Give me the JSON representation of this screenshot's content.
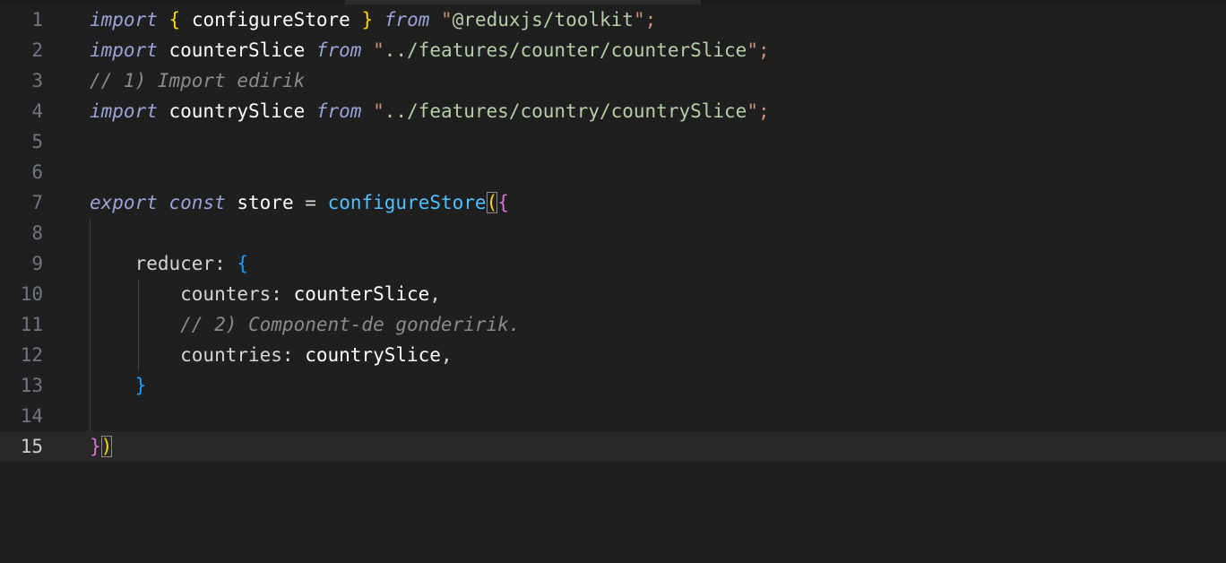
{
  "editor": {
    "lines": [
      {
        "number": "1",
        "tokens": [
          "import",
          " ",
          "{",
          " configureStore ",
          "}",
          " ",
          "from",
          " \"",
          "@reduxjs/toolkit",
          "\";"
        ]
      },
      {
        "number": "2",
        "tokens": [
          "import",
          " counterSlice ",
          "from",
          " \"",
          "../features/counter/counterSlice",
          "\";"
        ]
      },
      {
        "number": "3",
        "tokens": [
          "// 1) Import edirik"
        ]
      },
      {
        "number": "4",
        "tokens": [
          "import",
          " countrySlice ",
          "from",
          " \"",
          "../features/country/countrySlice",
          "\";"
        ]
      },
      {
        "number": "5",
        "tokens": [
          ""
        ]
      },
      {
        "number": "6",
        "tokens": [
          ""
        ]
      },
      {
        "number": "7",
        "tokens": [
          "export",
          " ",
          "const",
          " store ",
          "=",
          " ",
          "configureStore",
          "(",
          "{"
        ]
      },
      {
        "number": "8",
        "tokens": [
          ""
        ]
      },
      {
        "number": "9",
        "tokens": [
          "    reducer: ",
          "{"
        ]
      },
      {
        "number": "10",
        "tokens": [
          "        counters: ",
          "counterSlice",
          ","
        ]
      },
      {
        "number": "11",
        "tokens": [
          "        // 2) Component-de gonderirik."
        ]
      },
      {
        "number": "12",
        "tokens": [
          "        countries: ",
          "countrySlice",
          ","
        ]
      },
      {
        "number": "13",
        "tokens": [
          "    ",
          "}"
        ]
      },
      {
        "number": "14",
        "tokens": [
          ""
        ]
      },
      {
        "number": "15",
        "tokens": [
          "}",
          ")"
        ]
      }
    ],
    "current_line": "15"
  }
}
